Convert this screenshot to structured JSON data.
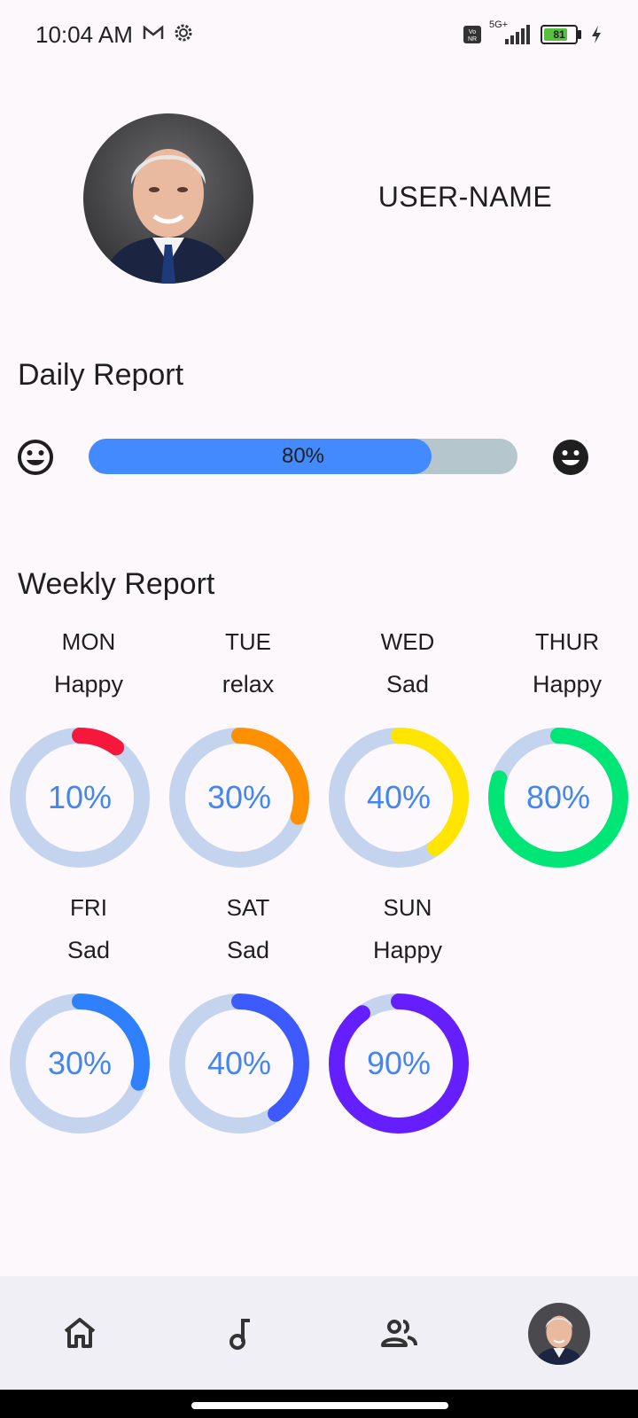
{
  "status_bar": {
    "time": "10:04 AM",
    "battery": "81",
    "network": "5G+"
  },
  "profile": {
    "username": "USER-NAME"
  },
  "daily_report": {
    "title": "Daily Report",
    "percent": 80,
    "percent_label": "80%"
  },
  "weekly_report": {
    "title": "Weekly Report",
    "days": [
      {
        "day": "MON",
        "mood": "Happy",
        "percent": 10,
        "label": "10%",
        "color": "#f5173c"
      },
      {
        "day": "TUE",
        "mood": "relax",
        "percent": 30,
        "label": "30%",
        "color": "#ff9100"
      },
      {
        "day": "WED",
        "mood": "Sad",
        "percent": 40,
        "label": "40%",
        "color": "#ffe500"
      },
      {
        "day": "THUR",
        "mood": "Happy",
        "percent": 80,
        "label": "80%",
        "color": "#00e676"
      },
      {
        "day": "FRI",
        "mood": "Sad",
        "percent": 30,
        "label": "30%",
        "color": "#2f80ff"
      },
      {
        "day": "SAT",
        "mood": "Sad",
        "percent": 40,
        "label": "40%",
        "color": "#3d5afe"
      },
      {
        "day": "SUN",
        "mood": "Happy",
        "percent": 90,
        "label": "90%",
        "color": "#651fff"
      }
    ]
  },
  "nav": {
    "items": [
      {
        "icon": "home-icon"
      },
      {
        "icon": "music-note-icon"
      },
      {
        "icon": "people-icon"
      },
      {
        "icon": "profile-avatar"
      }
    ]
  },
  "colors": {
    "track": "#c4d4ee",
    "percent_text": "#4386f0",
    "progress_fill": "#448aff",
    "progress_track": "#b5c7cd"
  }
}
